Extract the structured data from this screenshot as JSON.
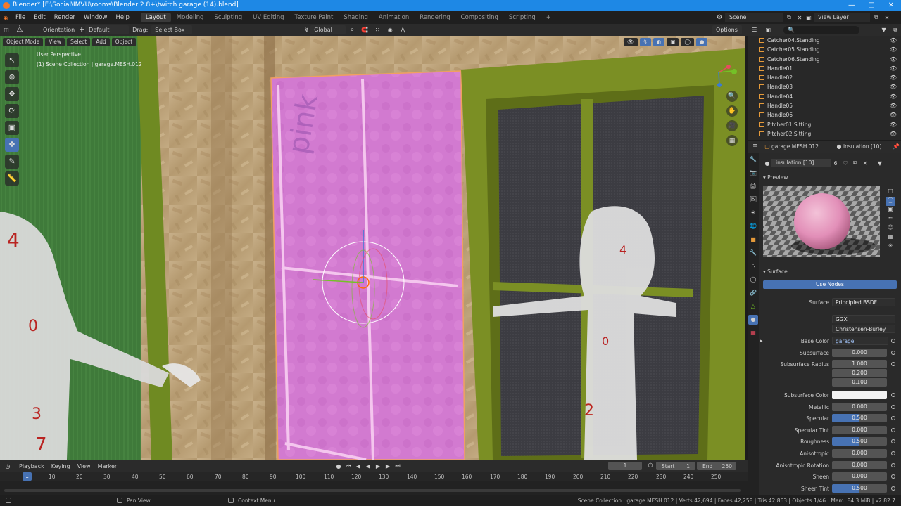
{
  "window": {
    "title": "Blender* [F:\\Social\\IMVU\\rooms\\Blender 2.8+\\twitch garage (14).blend]"
  },
  "menu": [
    "File",
    "Edit",
    "Render",
    "Window",
    "Help"
  ],
  "workspaces": [
    "Layout",
    "Modeling",
    "Sculpting",
    "UV Editing",
    "Texture Paint",
    "Shading",
    "Animation",
    "Rendering",
    "Compositing",
    "Scripting"
  ],
  "scene": {
    "label": "Scene",
    "view_layer": "View Layer"
  },
  "toolbar": {
    "orientation_label": "Orientation",
    "orientation_value": "Default",
    "drag_label": "Drag:",
    "drag_value": "Select Box",
    "transform": "Global",
    "options": "Options"
  },
  "viewport": {
    "mode": "Object Mode",
    "menus": [
      "View",
      "Select",
      "Add",
      "Object"
    ],
    "view_name": "User Perspective",
    "collection_info": "(1) Scene Collection | garage.MESH.012"
  },
  "outliner": {
    "items": [
      "Catcher04.Standing",
      "Catcher05.Standing",
      "Catcher06.Standing",
      "Handle01",
      "Handle02",
      "Handle03",
      "Handle04",
      "Handle05",
      "Handle06",
      "Pitcher01.Sitting",
      "Pitcher02.Sitting"
    ]
  },
  "properties": {
    "object_name": "garage.MESH.012",
    "material_tab": "insulation [10]",
    "material_name": "insulation [10]",
    "user_count": "6",
    "preview_label": "Preview",
    "surface_label": "Surface",
    "use_nodes": "Use Nodes",
    "surface_shader_label": "Surface",
    "surface_shader": "Principled BSDF",
    "distribution": "GGX",
    "subsurface_method": "Christensen-Burley",
    "fields": [
      {
        "label": "Base Color",
        "value": "garage insulation.tga"
      },
      {
        "label": "Subsurface",
        "value": "0.000"
      },
      {
        "label": "Subsurface Radius",
        "value": "1.000"
      },
      {
        "label": "",
        "value": "0.200"
      },
      {
        "label": "",
        "value": "0.100"
      },
      {
        "label": "Subsurface Color",
        "value": ""
      },
      {
        "label": "Metallic",
        "value": "0.000"
      },
      {
        "label": "Specular",
        "value": "0.500"
      },
      {
        "label": "Specular Tint",
        "value": "0.000"
      },
      {
        "label": "Roughness",
        "value": "0.500"
      },
      {
        "label": "Anisotropic",
        "value": "0.000"
      },
      {
        "label": "Anisotropic Rotation",
        "value": "0.000"
      },
      {
        "label": "Sheen",
        "value": "0.000"
      },
      {
        "label": "Sheen Tint",
        "value": "0.500"
      }
    ]
  },
  "timeline": {
    "menus": [
      "Playback",
      "Keying",
      "View",
      "Marker"
    ],
    "current_frame": "1",
    "start_label": "Start",
    "start": "1",
    "end_label": "End",
    "end": "250",
    "ticks": [
      "1",
      "10",
      "20",
      "30",
      "40",
      "50",
      "60",
      "70",
      "80",
      "90",
      "100",
      "110",
      "120",
      "130",
      "140",
      "150",
      "160",
      "170",
      "180",
      "190",
      "200",
      "210",
      "220",
      "230",
      "240",
      "250"
    ]
  },
  "status": {
    "pan": "Pan View",
    "context": "Context Menu",
    "stats": "Scene Collection | garage.MESH.012 | Verts:42,694 | Faces:42,258 | Tris:42,863 | Objects:1/46 | Mem: 84.3 MiB | v2.82.7"
  },
  "colors": {
    "accent": "#4772b3",
    "titlebar": "#1e88e5",
    "selection": "#e59a3a"
  }
}
